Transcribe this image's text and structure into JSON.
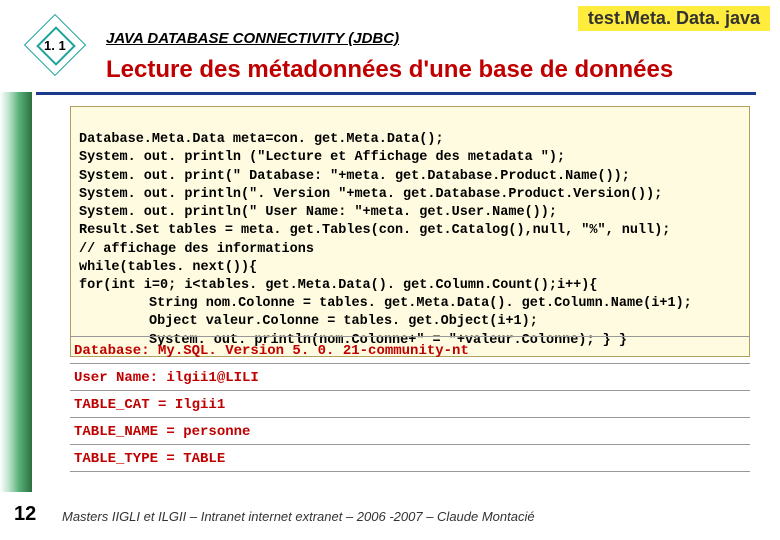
{
  "badge": "test.Meta. Data. java",
  "section_number": "1. 1",
  "section_label": "JAVA DATABASE CONNECTIVITY (JDBC)",
  "subtitle": "Lecture des métadonnées d'une base de données",
  "code": {
    "l1": "Database.Meta.Data meta=con. get.Meta.Data();",
    "l2": "System. out. println (\"Lecture et Affichage des metadata \");",
    "l3": "System. out. print(\" Database: \"+meta. get.Database.Product.Name());",
    "l4": "System. out. println(\". Version \"+meta. get.Database.Product.Version());",
    "l5": "System. out. println(\" User Name: \"+meta. get.User.Name());",
    "l6": "Result.Set tables = meta. get.Tables(con. get.Catalog(),null, \"%\", null);",
    "l7": "// affichage des informations",
    "l8": "while(tables. next()){",
    "l9": "for(int i=0; i<tables. get.Meta.Data(). get.Column.Count();i++){",
    "l10": "String nom.Colonne = tables. get.Meta.Data(). get.Column.Name(i+1);",
    "l11": "Object valeur.Colonne = tables. get.Object(i+1);",
    "l12": "System. out. println(nom.Colonne+\" = \"+valeur.Colonne); } }"
  },
  "output": {
    "o1": "Database: My.SQL. Version 5. 0. 21-community-nt",
    "o2": "User Name: ilgii1@LILI",
    "o3": "TABLE_CAT = Ilgii1",
    "o4": "TABLE_NAME = personne",
    "o5": "TABLE_TYPE = TABLE"
  },
  "page": "12",
  "footer": "Masters IIGLI et ILGII – Intranet internet extranet – 2006 -2007 – Claude Montacié"
}
